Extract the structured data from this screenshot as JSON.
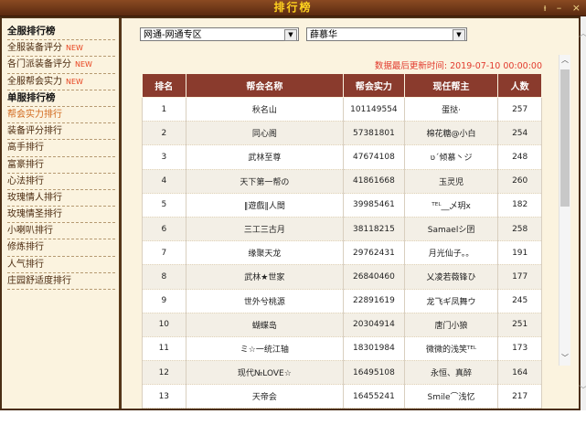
{
  "window": {
    "title": "排行榜",
    "minimize": "–",
    "close": "×",
    "pin": "ᵼ"
  },
  "sidebar": {
    "items": [
      {
        "label": "全服排行榜",
        "header": true
      },
      {
        "label": "全服装备评分",
        "new": "NEW"
      },
      {
        "label": "各门派装备评分",
        "new": "NEW"
      },
      {
        "label": "全服帮会实力",
        "new": "NEW"
      },
      {
        "label": "单服排行榜",
        "header": true
      },
      {
        "label": "帮会实力排行",
        "active": true
      },
      {
        "label": "装备评分排行"
      },
      {
        "label": "高手排行"
      },
      {
        "label": "富豪排行"
      },
      {
        "label": "心法排行"
      },
      {
        "label": "玫瑰情人排行"
      },
      {
        "label": "玫瑰情圣排行"
      },
      {
        "label": "小喇叭排行"
      },
      {
        "label": "修炼排行"
      },
      {
        "label": "人气排行"
      },
      {
        "label": "庄园舒适度排行"
      }
    ]
  },
  "filters": {
    "server": "网通-网通专区",
    "subserver": "薛慕华"
  },
  "update_text": "数据最后更新时间: 2019-07-10 00:00:00",
  "table": {
    "headers": [
      "排名",
      "帮会名称",
      "帮会实力",
      "现任帮主",
      "人数"
    ],
    "rows": [
      [
        "1",
        "秋名山",
        "101149554",
        "蛋挞·",
        "257"
      ],
      [
        "2",
        "同心阁",
        "57381801",
        "棉花糖@小白",
        "254"
      ],
      [
        "3",
        "武林至尊",
        "47674108",
        "ʋ´倾慕丶ジ",
        "248"
      ],
      [
        "4",
        "天下第一帮の",
        "41861668",
        "玉灵児",
        "260"
      ],
      [
        "5",
        "‖遊戲‖人間",
        "39985461",
        "ᵀᴱᴸ__乄玥ⅹ",
        "182"
      ],
      [
        "6",
        "三工三古月",
        "38118215",
        "Samaelシ囝",
        "258"
      ],
      [
        "7",
        "缘聚天龙",
        "29762431",
        "月光仙子。。",
        "191"
      ],
      [
        "8",
        "武林★世家",
        "26840460",
        "乂凌若薇锋ひ",
        "177"
      ],
      [
        "9",
        "世外兮桃源",
        "22891619",
        "龙飞ギ凤舞ウ",
        "245"
      ],
      [
        "10",
        "蝴蝶岛",
        "20304914",
        "唐门小狼",
        "251"
      ],
      [
        "11",
        "ミ☆一统江轴",
        "18301984",
        "微微的浅笑ᵀᴱᴸ",
        "173"
      ],
      [
        "12",
        "现代№LOVE☆",
        "16495108",
        "永恒、真醉",
        "164"
      ],
      [
        "13",
        "天帝会",
        "16455241",
        "Smile⌒浅忆",
        "217"
      ]
    ]
  }
}
